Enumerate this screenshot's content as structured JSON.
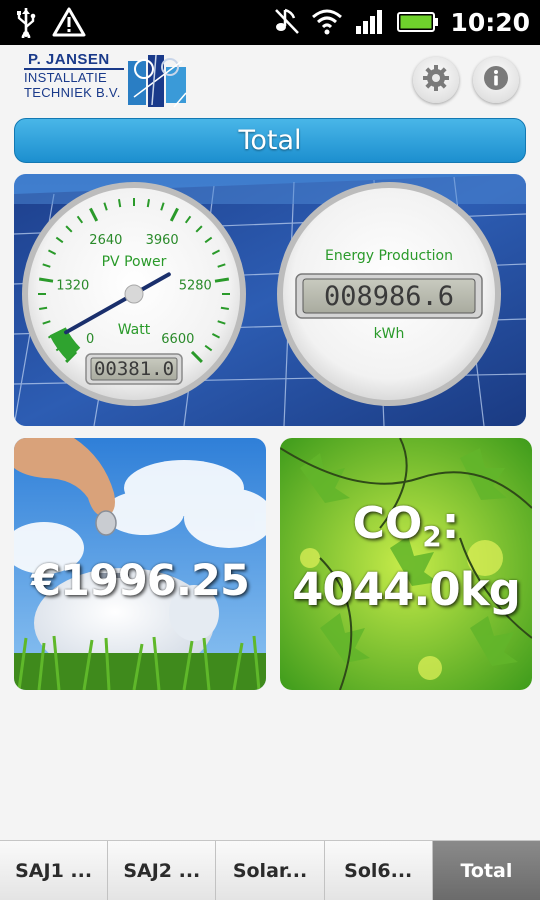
{
  "status_bar": {
    "time": "10:20",
    "icons": [
      "usb-icon",
      "warning-icon",
      "mute-icon",
      "wifi-icon",
      "signal-icon",
      "battery-icon"
    ]
  },
  "header": {
    "logo_lines": [
      "P. JANSEN",
      "INSTALLATIE",
      "TECHNIEK B.V."
    ],
    "buttons": [
      "settings-icon",
      "info-icon"
    ]
  },
  "title": "Total",
  "pv_power_gauge": {
    "label": "PV Power",
    "unit": "Watt",
    "ticks": [
      "0",
      "1320",
      "2640",
      "3960",
      "5280",
      "6600"
    ],
    "value": 381.0,
    "display": "00381.0"
  },
  "energy_meter": {
    "label": "Energy Production",
    "display": "008986.6",
    "unit": "kWh"
  },
  "savings": {
    "value": "€1996.25"
  },
  "co2": {
    "label": "CO",
    "subscript": "2",
    "suffix": ":",
    "value": "4044.0kg"
  },
  "tabs": [
    "SAJ1 ...",
    "SAJ2 ...",
    "Solar...",
    "Sol6...",
    "Total"
  ],
  "active_tab": 4,
  "colors": {
    "accent": "#2aa3de",
    "gauge_green": "#2fa32f",
    "tab_active": "#7a7a7a"
  }
}
